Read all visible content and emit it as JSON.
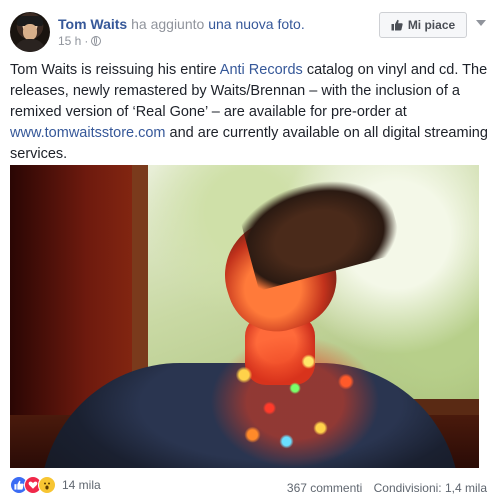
{
  "header": {
    "author": "Tom Waits",
    "action_text": "ha aggiunto",
    "action_link": "una nuova foto.",
    "time": "15 h",
    "separator": "·",
    "like_button_label": "Mi piace"
  },
  "post": {
    "text_1": "Tom Waits is reissuing his entire ",
    "link_1": "Anti Records",
    "text_2": " catalog on vinyl and cd. The releases, newly remastered by Waits/Brennan – with the inclusion of a remixed version of ‘Real Gone’ – are available for pre-order at ",
    "link_2": "www.tomwaitsstore.com",
    "text_3": " and are currently available on all digital streaming services."
  },
  "footer": {
    "reactions_count": "14 mila",
    "comments": "367 commenti",
    "shares": "Condivisioni: 1,4 mila"
  },
  "colors": {
    "link": "#365899",
    "meta": "#90949c",
    "like_reaction": "#3b6cf4",
    "love_reaction": "#f0284a",
    "wow_reaction": "#f7c532"
  }
}
